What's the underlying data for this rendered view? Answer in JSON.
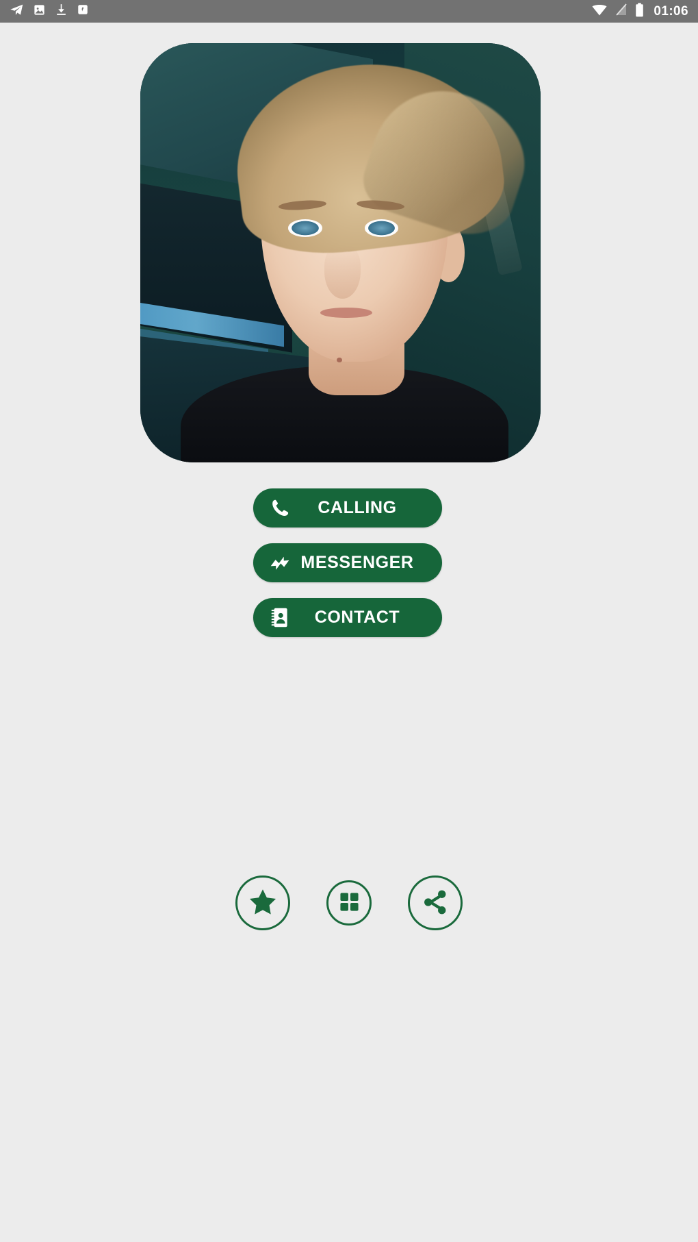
{
  "status_bar": {
    "background_color": "#727272",
    "time": "01:06",
    "left_icons": [
      {
        "name": "telegram-icon",
        "label": "Telegram notification"
      },
      {
        "name": "gallery-icon",
        "label": "Gallery notification"
      },
      {
        "name": "download-icon",
        "label": "Download complete"
      },
      {
        "name": "app-notification-icon",
        "label": "App notification"
      }
    ],
    "right_icons": [
      {
        "name": "wifi-icon",
        "label": "Wi-Fi connected"
      },
      {
        "name": "no-signal-icon",
        "label": "No mobile signal"
      },
      {
        "name": "battery-icon",
        "label": "Battery full"
      }
    ]
  },
  "theme": {
    "background_color": "#ECECEC",
    "accent_color": "#16663A",
    "accent_outline_color": "#1A6A3C",
    "button_text_color": "#FFFFFF"
  },
  "profile": {
    "avatar_name": "contact-photo",
    "avatar_alt": "Portrait photo of a young man with blond swept-up hair wearing a black t-shirt"
  },
  "actions": [
    {
      "id": "calling",
      "label": "CALLING",
      "icon": "phone-icon"
    },
    {
      "id": "messenger",
      "label": "MESSENGER",
      "icon": "messenger-icon"
    },
    {
      "id": "contact",
      "label": "CONTACT",
      "icon": "contact-book-icon"
    }
  ],
  "bottom_actions": [
    {
      "id": "favorite",
      "icon": "star-icon",
      "label": "Favorite"
    },
    {
      "id": "apps",
      "icon": "grid-icon",
      "label": "Apps"
    },
    {
      "id": "share",
      "icon": "share-icon",
      "label": "Share"
    }
  ]
}
